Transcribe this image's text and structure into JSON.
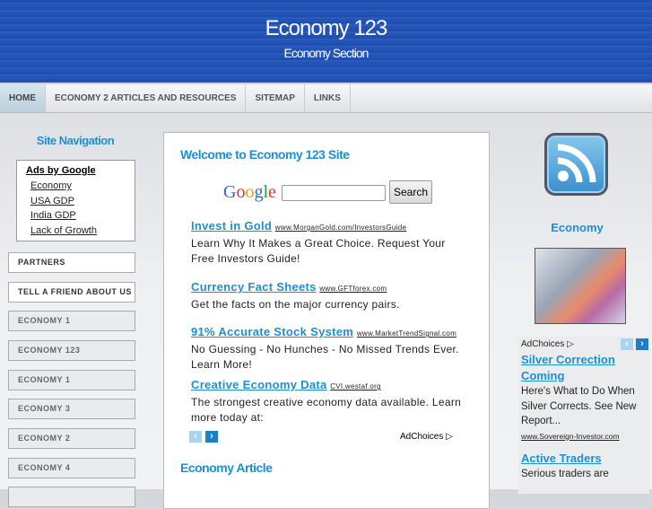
{
  "header": {
    "title": "Economy 123",
    "subtitle": "Economy Section"
  },
  "nav": [
    "HOME",
    "ECONOMY 2 ARTICLES AND RESOURCES",
    "SITEMAP",
    "LINKS"
  ],
  "left": {
    "heading": "Site Navigation",
    "ads_title": "Ads by Google",
    "ad_links": [
      "Economy",
      "USA GDP",
      "India GDP",
      "Lack of Growth"
    ],
    "buttons": [
      "PARTNERS",
      "TELL A FRIEND ABOUT US",
      "ECONOMY 1",
      "ECONOMY 123",
      "ECONOMY 1",
      "ECONOMY 3",
      "ECONOMY 2",
      "ECONOMY 4"
    ]
  },
  "main": {
    "welcome": "Welcome to Economy 123 Site",
    "google": "Google",
    "search_label": "Search",
    "ads": [
      {
        "title": "Invest in Gold",
        "url": "www.MorganGold.com/InvestorsGuide",
        "text": "Learn Why It Makes a Great Choice. Request Your Free Investors Guide!"
      },
      {
        "title": "Currency Fact Sheets",
        "url": "www.GFTforex.com",
        "text": "Get the facts on the major currency pairs."
      },
      {
        "title": "91% Accurate Stock System",
        "url": "www.MarketTrendSignal.com",
        "text": "No Guessing - No Hunches - No Missed Trends Ever. Learn More!"
      },
      {
        "title": "Creative Economy Data",
        "url": "CVI.westaf.org",
        "text": "The strongest creative economy data available. Learn more today at:"
      }
    ],
    "adchoices": "AdChoices",
    "article_heading": "Economy Article"
  },
  "right": {
    "heading": "Economy",
    "adchoices": "AdChoices",
    "ads": [
      {
        "title": "Silver Correction Coming",
        "text": "Here's What to Do When Silver Corrects. See New Report...",
        "url": "www.Sovereign-Investor.com"
      },
      {
        "title": "Active Traders",
        "text": "Serious traders are"
      }
    ]
  }
}
